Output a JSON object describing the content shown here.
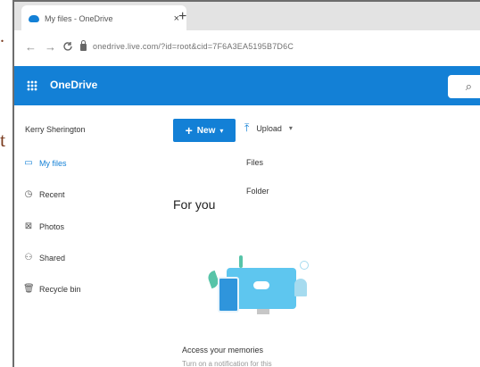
{
  "slide": {
    "glyph_top": ".",
    "glyph_mid": "t"
  },
  "browser": {
    "tab_title": "My files - OneDrive",
    "tab_close": "×",
    "new_tab": "+",
    "back": "←",
    "forward": "→",
    "url": "onedrive.live.com/?id=root&cid=7F6A3EA5195B7D6C"
  },
  "app": {
    "name": "OneDrive",
    "search_placeholder": "Search"
  },
  "sidebar": {
    "user": "Kerry Sherington",
    "items": [
      {
        "label": "My files",
        "icon": "folder-icon",
        "active": true
      },
      {
        "label": "Recent",
        "icon": "clock-icon",
        "active": false
      },
      {
        "label": "Photos",
        "icon": "photo-icon",
        "active": false
      },
      {
        "label": "Shared",
        "icon": "people-icon",
        "active": false
      },
      {
        "label": "Recycle bin",
        "icon": "trash-icon",
        "active": false
      }
    ]
  },
  "toolbar": {
    "new_label": "New",
    "upload_label": "Upload"
  },
  "upload_menu": {
    "files": "Files",
    "folder": "Folder"
  },
  "main": {
    "heading": "For you",
    "access_title": "Access your memories",
    "access_sub": "Turn on a notification for this"
  },
  "colors": {
    "brand": "#1380d6"
  }
}
